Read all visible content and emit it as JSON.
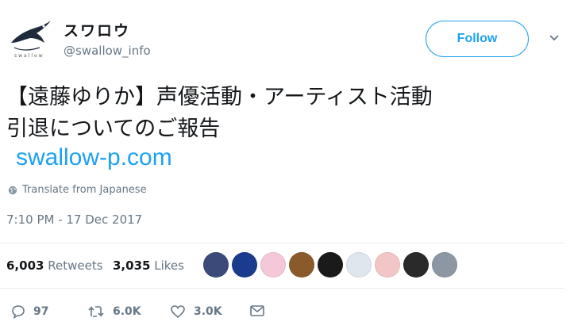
{
  "header": {
    "display_name": "スワロウ",
    "handle": "@swallow_info",
    "follow_label": "Follow"
  },
  "tweet": {
    "line1": "【遠藤ゆりか】声優活動・アーティスト活動",
    "line2": "引退についてのご報告",
    "link": "swallow-p.com",
    "translate": "Translate from Japanese",
    "timestamp": "7:10 PM - 17 Dec 2017"
  },
  "stats": {
    "retweets_count": "6,003",
    "retweets_label": "Retweets",
    "likes_count": "3,035",
    "likes_label": "Likes"
  },
  "likers": [
    {
      "color": "#3c4a7a"
    },
    {
      "color": "#1b3c8c"
    },
    {
      "color": "#f4c8d8"
    },
    {
      "color": "#8b5a2b"
    },
    {
      "color": "#1a1a1a"
    },
    {
      "color": "#dfe7ee"
    },
    {
      "color": "#f2c6c6"
    },
    {
      "color": "#2a2a2a"
    },
    {
      "color": "#8d97a3"
    }
  ],
  "actions": {
    "reply_count": "97",
    "retweet_count": "6.0K",
    "like_count": "3.0K"
  },
  "colors": {
    "accent": "#1da1f2",
    "muted": "#657786",
    "text": "#14171a"
  }
}
